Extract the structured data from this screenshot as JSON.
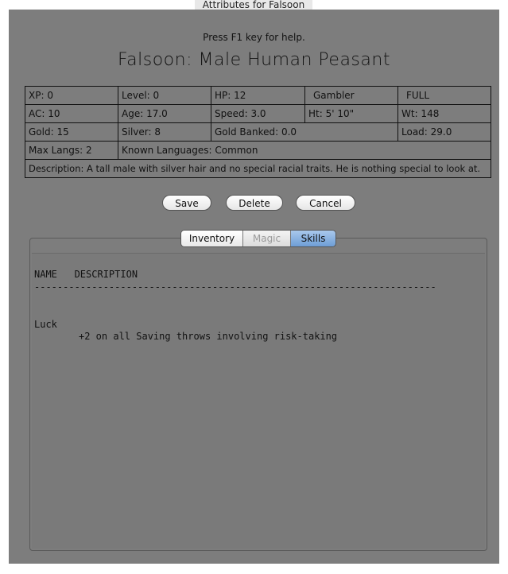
{
  "window": {
    "title": "Attributes for Falsoon"
  },
  "header": {
    "help_text": "Press F1 key for help.",
    "character_title": "Falsoon: Male Human Peasant"
  },
  "stats": {
    "xp": "XP:  0",
    "level": "Level:  0",
    "hp": "HP:  12",
    "occupation": "Gambler",
    "hp_status": "FULL",
    "ac": "AC:  10",
    "age": "Age:  17.0",
    "speed": "Speed:  3.0",
    "height": "Ht:  5' 10\"",
    "weight": "Wt:  148",
    "gold": "Gold:  15",
    "silver": "Silver:  8",
    "gold_banked": "Gold Banked:  0.0",
    "load": "Load:  29.0",
    "max_langs": "Max Langs:  2",
    "known_languages": "Known Languages:  Common",
    "description": "Description: A tall male with silver hair and no special racial traits. He is nothing special to look at."
  },
  "buttons": {
    "save": "Save",
    "delete": "Delete",
    "cancel": "Cancel"
  },
  "tabs": {
    "inventory": "Inventory",
    "magic": "Magic",
    "skills": "Skills",
    "selected": "Skills"
  },
  "skills_panel": {
    "header": "NAME   DESCRIPTION",
    "divider": "----------------------------------------------------------------------",
    "skill_name": "Luck",
    "skill_description": "+2 on all Saving throws involving risk-taking"
  },
  "colors": {
    "panel_bg": "#7d7d7d",
    "selected_tab": "#7fa8dc"
  }
}
